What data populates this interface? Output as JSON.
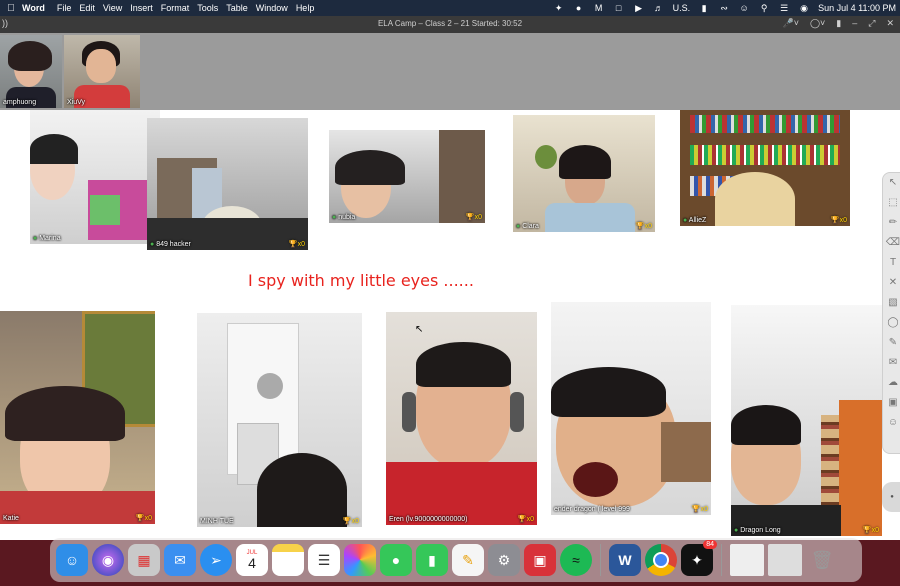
{
  "menubar": {
    "app": "Word",
    "items": [
      "File",
      "Edit",
      "View",
      "Insert",
      "Format",
      "Tools",
      "Table",
      "Window",
      "Help"
    ],
    "status": {
      "input_source": "U.S.",
      "clock": "Sun Jul 4  11:00 PM"
    }
  },
  "meeting": {
    "title": "ELA Camp – Class 2 – 21   Started: 30:52"
  },
  "teachers": [
    {
      "name": "amphuong"
    },
    {
      "name": "XiuVy"
    }
  ],
  "canvas_text": "I spy with my little eyes ......",
  "students": [
    {
      "name": "Marina",
      "stars": ""
    },
    {
      "name": "849 hacker",
      "stars": "x0"
    },
    {
      "name": "nubia",
      "stars": "x0"
    },
    {
      "name": "Clara",
      "stars": "x0"
    },
    {
      "name": "AllieZ",
      "stars": "x0"
    },
    {
      "name": "Katie",
      "stars": "x0"
    },
    {
      "name": "MINH TUE",
      "stars": "x0"
    },
    {
      "name": "Eren (lv.9000000000000)",
      "stars": "x0"
    },
    {
      "name": "ender dragon ( level 999",
      "stars": "x0"
    },
    {
      "name": "Dragon Long",
      "stars": "x0"
    }
  ],
  "dock": {
    "calendar_month": "JUL",
    "calendar_day": "4",
    "mail_badge": "84",
    "apps": [
      "finder-icon",
      "siri-icon",
      "launchpad-icon",
      "mail-icon",
      "safari-icon",
      "calendar-icon",
      "notes-icon",
      "reminders-icon",
      "photos-icon",
      "messages-icon",
      "facetime-icon",
      "pages-icon",
      "system-preferences-icon",
      "presentation-icon",
      "spotify-icon",
      "word-icon",
      "chrome-icon",
      "messenger-icon"
    ],
    "colors": {
      "accent": "#e8231e",
      "dock_bg": "#5a1820"
    }
  }
}
